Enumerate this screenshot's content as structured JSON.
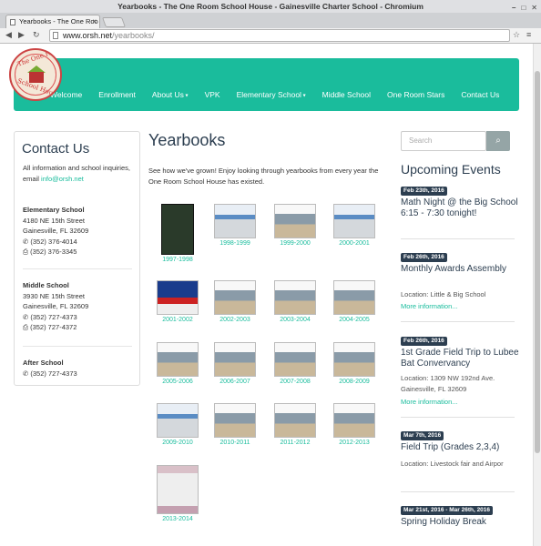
{
  "window": {
    "title": "Yearbooks - The One Room School House - Gainesville Charter School - Chromium"
  },
  "tab": {
    "label": "Yearbooks - The One Roo"
  },
  "address": {
    "host": "www.orsh.net",
    "path": "/yearbooks/"
  },
  "logo": {
    "top": "The One Room",
    "bottom": "School House"
  },
  "nav": [
    {
      "label": "Welcome"
    },
    {
      "label": "Enrollment"
    },
    {
      "label": "About Us",
      "caret": true
    },
    {
      "label": "VPK"
    },
    {
      "label": "Elementary School",
      "caret": true
    },
    {
      "label": "Middle School"
    },
    {
      "label": "One Room Stars"
    },
    {
      "label": "Contact Us"
    }
  ],
  "contact": {
    "heading": "Contact Us",
    "intro": "All information and school inquiries, email",
    "email": "info@orsh.net",
    "elementary": {
      "name": "Elementary School",
      "addr1": "4180 NE 15th Street",
      "addr2": "Gainesville, FL 32609",
      "phone": "(352) 376-4014",
      "fax": "(352) 376-3345"
    },
    "middle": {
      "name": "Middle School",
      "addr1": "3930 NE 15th Street",
      "addr2": "Gainesville, FL 32609",
      "phone": "(352) 727-4373",
      "fax": "(352) 727-4372"
    },
    "after": {
      "name": "After School",
      "phone": "(352) 727-4373"
    }
  },
  "main": {
    "title": "Yearbooks",
    "intro": "See how we've grown! Enjoy looking through yearbooks from every year the One Room School House has existed."
  },
  "yearbooks": [
    "1997-1998",
    "1998-1999",
    "1999-2000",
    "2000-2001",
    "2001-2002",
    "2002-2003",
    "2003-2004",
    "2004-2005",
    "2005-2006",
    "2006-2007",
    "2007-2008",
    "2008-2009",
    "2009-2010",
    "2010-2011",
    "2011-2012",
    "2012-2013",
    "2013-2014"
  ],
  "search": {
    "placeholder": "Search"
  },
  "events": {
    "heading": "Upcoming Events",
    "items": [
      {
        "date": "Feb 23th, 2016",
        "title": "Math Night @ the Big School 6:15 - 7:30 tonight!"
      },
      {
        "date": "Feb 26th, 2016",
        "title": "Monthly Awards Assembly",
        "location": "Location: Little & Big School",
        "more": "More information..."
      },
      {
        "date": "Feb 26th, 2016",
        "title": "1st Grade Field Trip to Lubee Bat Convervancy",
        "location": "Location: 1309 NW 192nd Ave. Gainesville, FL 32609",
        "more": "More information..."
      },
      {
        "date": "Mar 7th, 2016",
        "title": "Field Trip (Grades 2,3,4)",
        "location": "Location: Livestock fair and Airpor"
      },
      {
        "date": "Mar 21st, 2016 - Mar 26th, 2016",
        "title": "Spring Holiday Break"
      }
    ]
  }
}
